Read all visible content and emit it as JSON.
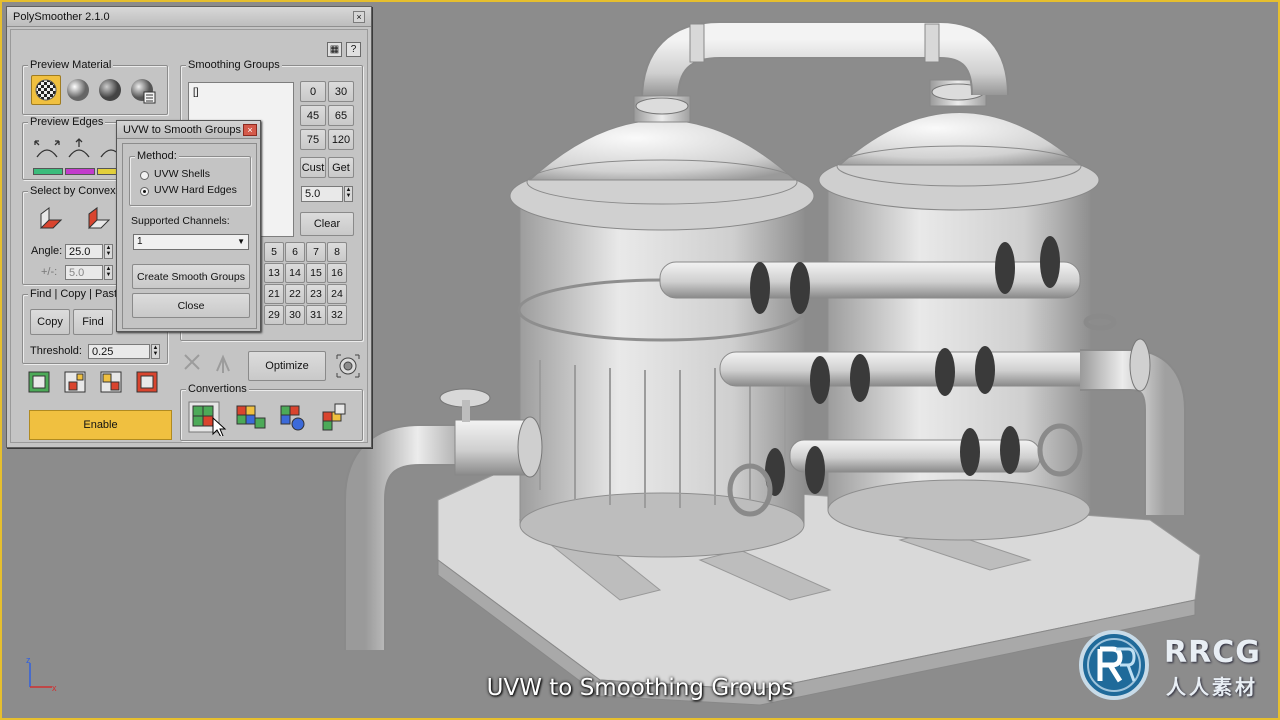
{
  "panel": {
    "title": "PolySmoother 2.1.0",
    "close_glyph": "×",
    "help_glyph": "?",
    "preview_material": {
      "label": "Preview Material",
      "swatches": [
        "checker-sphere-icon",
        "grey-sphere-icon",
        "dark-sphere-icon",
        "material-editor-icon"
      ]
    },
    "preview_edges": {
      "label": "Preview Edges",
      "colors": [
        "#3cbc7c",
        "#c23ccc",
        "#e2cf3b"
      ]
    },
    "select_by_convexity": {
      "label": "Select by Convexi",
      "angle_label": "Angle:",
      "angle_value": "25.0",
      "tol_label": "+/-:",
      "tol_value": "5.0"
    },
    "find_copy": {
      "label": "Find | Copy | Past",
      "copy_label": "Copy",
      "find_label": "Find",
      "threshold_label": "Threshold:",
      "threshold_value": "0.25"
    },
    "smoothing_groups": {
      "label": "Smoothing Groups",
      "list_item": "[]",
      "angles": [
        "0",
        "30",
        "45",
        "65",
        "75",
        "120"
      ],
      "cust_label": "Cust",
      "get_label": "Get",
      "angle_value": "5.0",
      "clear_label": "Clear",
      "grid_rows": [
        [
          "5",
          "6",
          "7",
          "8"
        ],
        [
          "13",
          "14",
          "15",
          "16"
        ],
        [
          "21",
          "22",
          "23",
          "24"
        ],
        [
          "29",
          "30",
          "31",
          "32"
        ]
      ]
    },
    "optimize_label": "Optimize",
    "convertions": {
      "label": "Convertions"
    },
    "enable_label": "Enable"
  },
  "dialog": {
    "title": "UVW to Smooth Groups",
    "close_glyph": "×",
    "method_label": "Method:",
    "option_shells": "UVW Shells",
    "option_hard_edges": "UVW Hard Edges",
    "selected_option": "UVW Hard Edges",
    "channels_label": "Supported Channels:",
    "channel_value": "1",
    "create_label": "Create Smooth Groups",
    "close_label": "Close"
  },
  "viewport": {
    "caption": "UVW to Smoothing Groups",
    "border_color": "#e6bf2e",
    "axis_labels": {
      "x": "x",
      "z": "z"
    }
  },
  "watermark": {
    "line1": "RRCG",
    "line2": "人人素材"
  }
}
